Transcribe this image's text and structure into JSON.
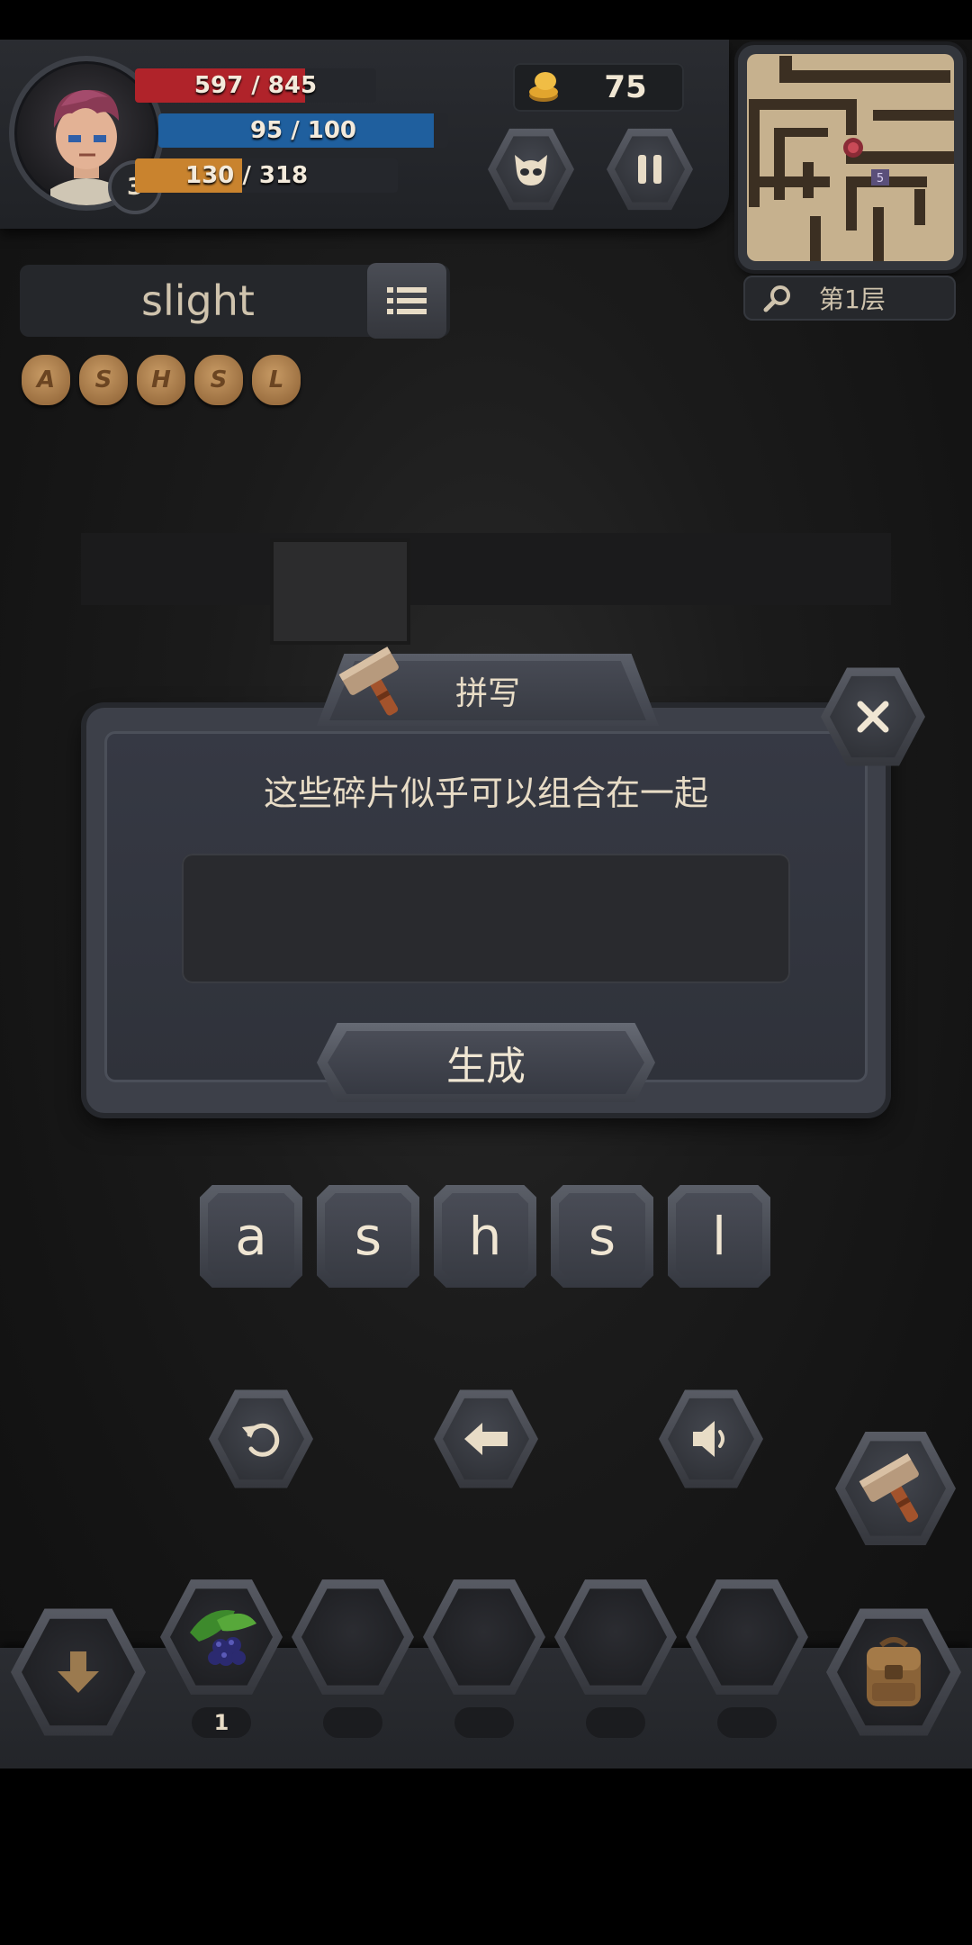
{
  "player": {
    "level": "3",
    "hp_text": "597 / 845",
    "hp_fraction": 0.7065,
    "mp_text": "95 / 100",
    "mp_fraction": 0.95,
    "xp_text": "130 / 318",
    "xp_fraction": 0.4088,
    "coins": "75"
  },
  "minimap": {
    "marker": "5",
    "floor_label": "第1层"
  },
  "word": {
    "current": "slight",
    "fragments": [
      "A",
      "S",
      "H",
      "S",
      "L"
    ]
  },
  "dialog": {
    "title": "拼写",
    "message": "这些碎片似乎可以组合在一起",
    "input_value": "",
    "generate_label": "生成"
  },
  "letter_keys": [
    "a",
    "s",
    "h",
    "s",
    "l"
  ],
  "inventory": {
    "slot1_count": "1"
  },
  "colors": {
    "hp": "#b0232a",
    "mp": "#1f5f9e",
    "xp": "#c9832e",
    "text_cream": "#e8dcc6",
    "panel": "#3d4049"
  },
  "icons": {
    "coin": "coin-stack-icon",
    "monster": "monster-face-icon",
    "pause": "pause-icon",
    "search": "magnifier-icon",
    "menu": "list-icon",
    "hammer": "hammer-icon",
    "close": "close-icon",
    "reset": "reset-icon",
    "backspace": "backspace-arrow-icon",
    "sound": "speaker-icon",
    "drop": "down-arrow-icon",
    "berries": "blackberry-icon",
    "bag": "backpack-icon"
  }
}
